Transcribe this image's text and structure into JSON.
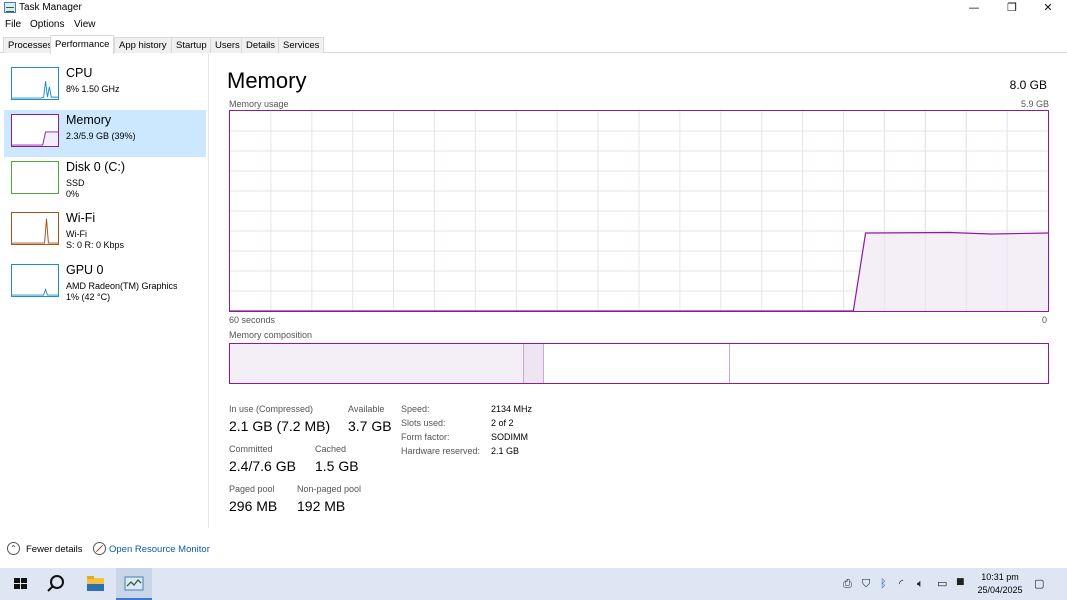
{
  "window": {
    "title": "Task Manager",
    "controls": {
      "minimize": "—",
      "restore": "❐",
      "close": "✕"
    }
  },
  "menu": [
    "File",
    "Options",
    "View"
  ],
  "tabs": [
    "Processes",
    "Performance",
    "App history",
    "Startup",
    "Users",
    "Details",
    "Services"
  ],
  "sidebar": {
    "items": [
      {
        "name": "CPU",
        "line1": "8% 1.50 GHz",
        "line2": "",
        "color": "#1e8cd3"
      },
      {
        "name": "Memory",
        "line1": "2.3/5.9 GB (39%)",
        "line2": "",
        "color": "#8b1a9f"
      },
      {
        "name": "Disk 0 (C:)",
        "line1": "SSD",
        "line2": "0%",
        "color": "#4ea83a"
      },
      {
        "name": "Wi-Fi",
        "line1": "Wi-Fi",
        "line2": "S: 0 R: 0 Kbps",
        "color": "#a8511a"
      },
      {
        "name": "GPU 0",
        "line1": "AMD Radeon(TM) Graphics",
        "line2": "1% (42 °C)",
        "color": "#1e8cd3"
      }
    ]
  },
  "main": {
    "title": "Memory",
    "total": "8.0 GB",
    "usage_label": "Memory usage",
    "usage_max": "5.9 GB",
    "time_left": "60 seconds",
    "time_right": "0",
    "composition_label": "Memory composition",
    "accent": "#8b1a9f",
    "usage_level": 0.39,
    "composition": {
      "in_use_fraction": 0.36,
      "modified_fraction": 0.024,
      "standby_fraction": 0.227
    }
  },
  "stats": {
    "in_use_label": "In use (Compressed)",
    "in_use_value": "2.1 GB (7.2 MB)",
    "available_label": "Available",
    "available_value": "3.7 GB",
    "committed_label": "Committed",
    "committed_value": "2.4/7.6 GB",
    "cached_label": "Cached",
    "cached_value": "1.5 GB",
    "paged_label": "Paged pool",
    "paged_value": "296 MB",
    "nonpaged_label": "Non-paged pool",
    "nonpaged_value": "192 MB"
  },
  "info": {
    "speed_label": "Speed:",
    "speed_value": "2134 MHz",
    "slots_label": "Slots used:",
    "slots_value": "2 of 2",
    "form_label": "Form factor:",
    "form_value": "SODIMM",
    "reserved_label": "Hardware reserved:",
    "reserved_value": "2.1 GB"
  },
  "footer": {
    "fewer_details": "Fewer details",
    "open_resource_monitor": "Open Resource Monitor"
  },
  "taskbar": {
    "time": "10:31 pm",
    "date": "25/04/2025",
    "icons": [
      "windows-start-icon",
      "search-icon",
      "file-explorer-icon",
      "task-manager-icon"
    ]
  }
}
